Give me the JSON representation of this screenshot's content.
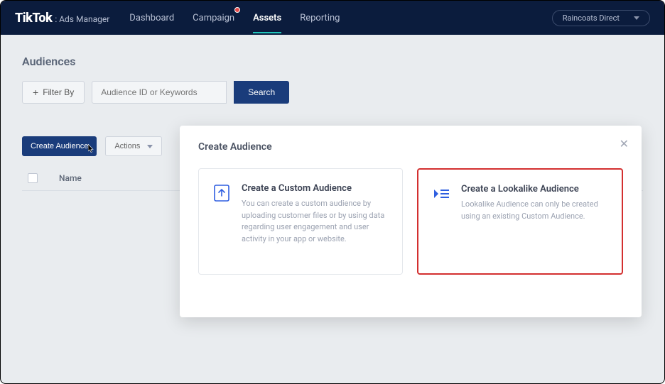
{
  "brand": {
    "logo": "TikTok",
    "sub": ": Ads Manager"
  },
  "nav": {
    "items": [
      {
        "label": "Dashboard",
        "active": false,
        "badge": false
      },
      {
        "label": "Campaign",
        "active": false,
        "badge": true
      },
      {
        "label": "Assets",
        "active": true,
        "badge": false
      },
      {
        "label": "Reporting",
        "active": false,
        "badge": false
      }
    ]
  },
  "account_selector": {
    "label": "Raincoats Direct"
  },
  "page": {
    "title": "Audiences"
  },
  "filter": {
    "button_label": "Filter By",
    "search_placeholder": "Audience ID or Keywords",
    "search_button": "Search"
  },
  "toolbar": {
    "create_label": "Create Audience",
    "actions_label": "Actions"
  },
  "table": {
    "headers": {
      "name": "Name"
    }
  },
  "modal": {
    "title": "Create Audience",
    "cards": [
      {
        "title": "Create a Custom Audience",
        "desc": "You can create a custom audience by uploading customer files or by using data regarding user engagement and user activity in your app or website.",
        "highlight": false,
        "icon": "upload-file-icon"
      },
      {
        "title": "Create a Lookalike Audience",
        "desc": "Lookalike Audience can only be created using an existing Custom Audience.",
        "highlight": true,
        "icon": "lookalike-icon"
      }
    ]
  },
  "colors": {
    "nav_bg": "#0b1c3d",
    "primary": "#1a3c7b",
    "accent": "#20c5ba",
    "danger": "#d32f2f"
  }
}
